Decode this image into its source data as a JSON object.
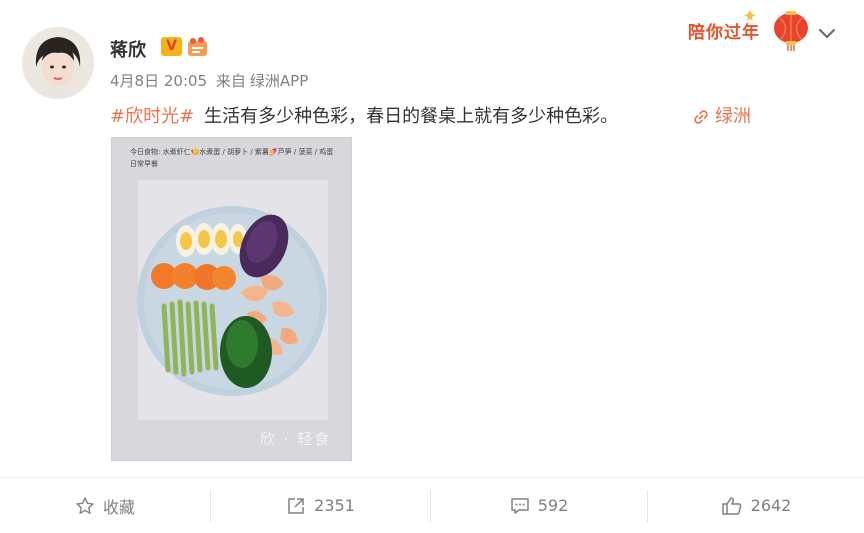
{
  "author": {
    "name": "蒋欣",
    "verified_badge": "V",
    "avatar": "avatar-photo"
  },
  "festival_badge": {
    "text": "陪你过年"
  },
  "meta": {
    "time": "4月8日 20:05",
    "source_prefix": "来自",
    "source": "绿洲APP"
  },
  "post": {
    "hashtag": "#欣时光#",
    "text": "生活有多少种色彩，春日的餐桌上就有多少种色彩。",
    "location_label": "绿洲"
  },
  "image": {
    "caption": "今日食物: 水煮虾仁🍤水煮蛋 / 胡萝卜 / 紫薯🍠芦笋 / 菠菜 / 鸡蛋 日常早餐",
    "signature": "欣 · 轻食"
  },
  "actions": {
    "favorite": "收藏",
    "repost": "2351",
    "comments": "592",
    "likes": "2642"
  },
  "colors": {
    "accent": "#eb7350",
    "text": "#333333",
    "muted": "#808080"
  }
}
